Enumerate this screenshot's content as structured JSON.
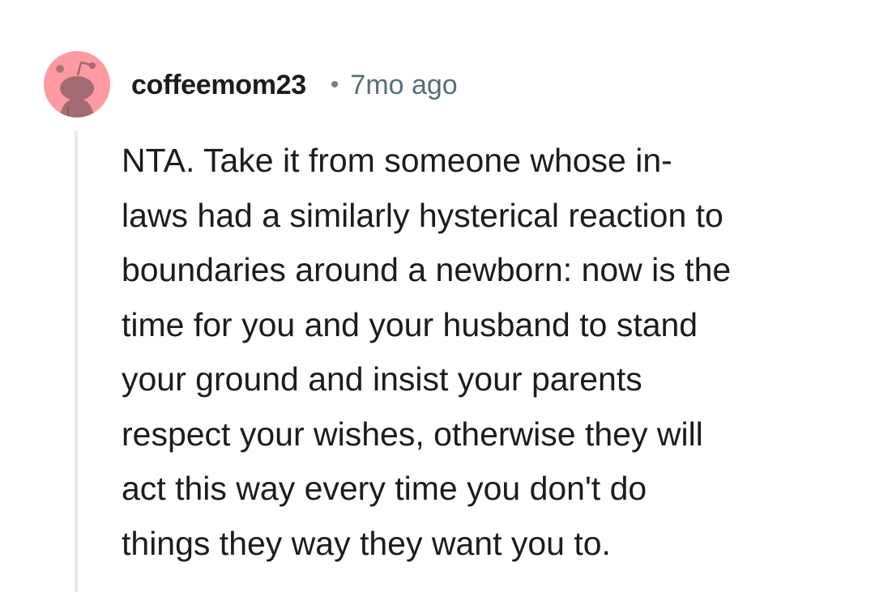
{
  "comment": {
    "author": "coffeemom23",
    "separator": "•",
    "timestamp": "7mo ago",
    "avatar_icon": "snoo-avatar-icon",
    "avatar_color": "#ff9aa2",
    "body": "NTA. Take it from someone whose in-\nlaws had a similarly hysterical reaction to\nboundaries around a newborn: now is the\ntime for you and your husband to stand\nyour ground and insist your parents\nrespect your wishes, otherwise they will\nact this way every time you don't do\nthings they way they want you to."
  }
}
